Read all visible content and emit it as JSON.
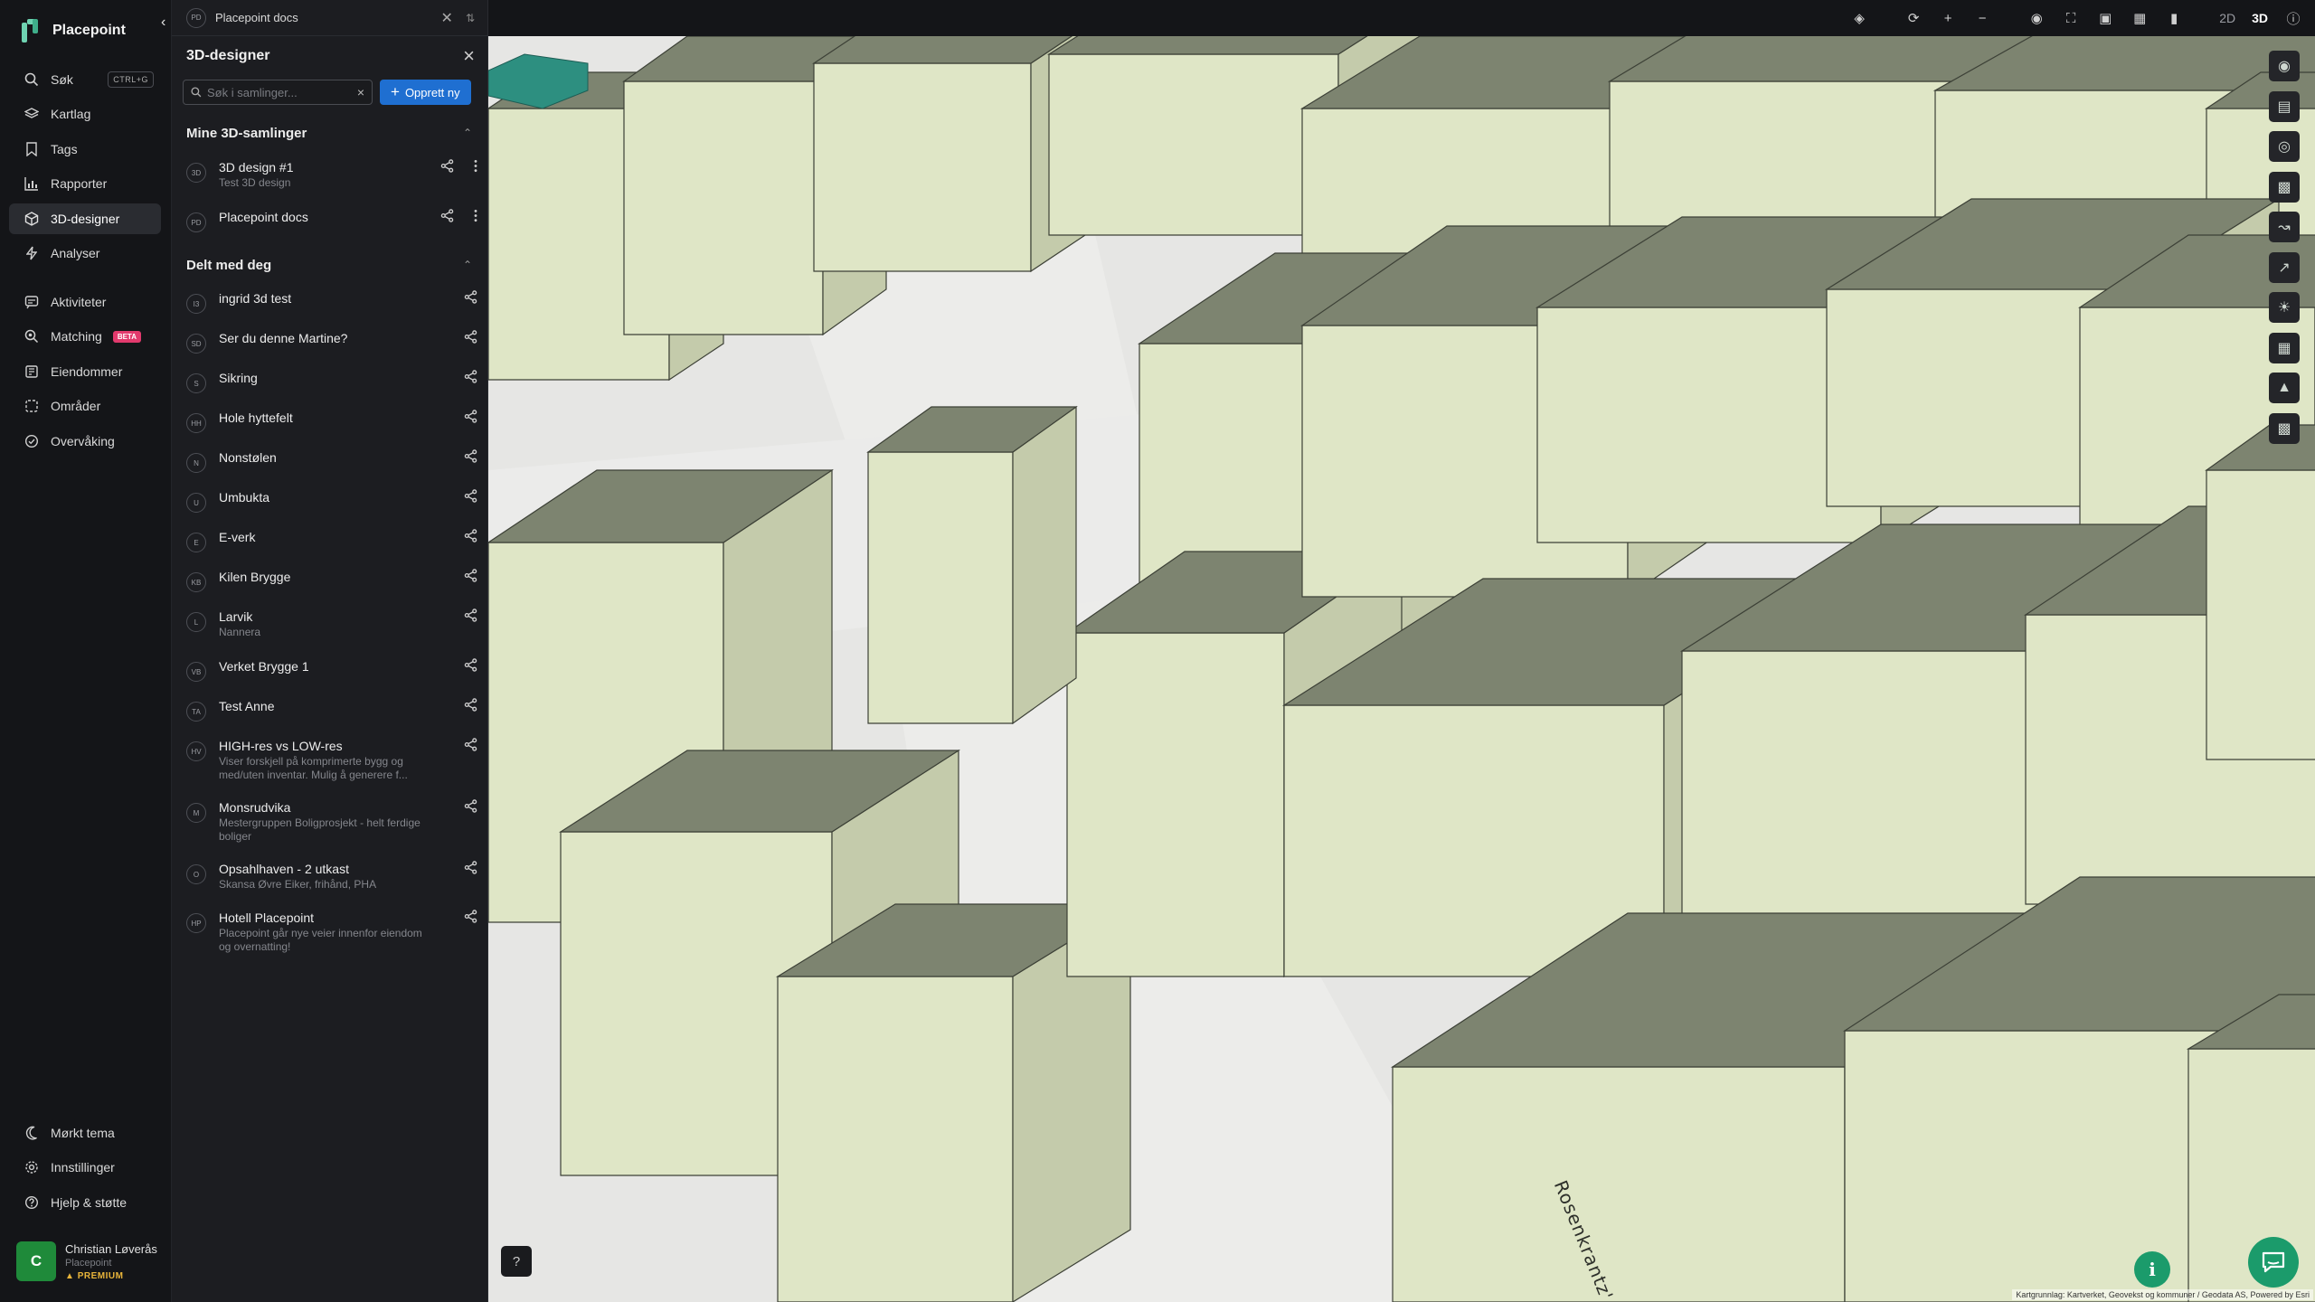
{
  "app": {
    "brand": "Placepoint"
  },
  "nav": {
    "search": {
      "label": "Søk",
      "shortcut": "CTRL+G"
    },
    "items": [
      {
        "label": "Kartlag",
        "icon": "layers-icon"
      },
      {
        "label": "Tags",
        "icon": "bookmark-icon"
      },
      {
        "label": "Rapporter",
        "icon": "bar-chart-icon"
      },
      {
        "label": "3D-designer",
        "icon": "cube-icon",
        "active": true
      },
      {
        "label": "Analyser",
        "icon": "bolt-icon"
      },
      {
        "label": "Aktiviteter",
        "icon": "activity-icon"
      },
      {
        "label": "Matching",
        "icon": "match-icon",
        "badge": "BETA"
      },
      {
        "label": "Eiendommer",
        "icon": "property-icon"
      },
      {
        "label": "Områder",
        "icon": "area-icon"
      },
      {
        "label": "Overvåking",
        "icon": "monitor-icon"
      }
    ],
    "bottom": [
      {
        "label": "Mørkt tema",
        "icon": "moon-icon"
      },
      {
        "label": "Innstillinger",
        "icon": "gear-icon"
      },
      {
        "label": "Hjelp & støtte",
        "icon": "help-icon"
      }
    ],
    "user": {
      "initial": "C",
      "name": "Christian Løverås",
      "org": "Placepoint",
      "plan": "PREMIUM"
    }
  },
  "panel": {
    "context": {
      "initials": "PD",
      "title": "Placepoint docs"
    },
    "title": "3D-designer",
    "search_placeholder": "Søk i samlinger...",
    "new_button": "Opprett ny",
    "my_section": "Mine 3D-samlinger",
    "my_items": [
      {
        "initials": "3D",
        "name": "3D design #1",
        "sub": "Test 3D design"
      },
      {
        "initials": "PD",
        "name": "Placepoint docs",
        "sub": ""
      }
    ],
    "shared_section": "Delt med deg",
    "shared_items": [
      {
        "initials": "I3",
        "name": "ingrid 3d test",
        "sub": ""
      },
      {
        "initials": "SD",
        "name": "Ser du denne Martine?",
        "sub": ""
      },
      {
        "initials": "S",
        "name": "Sikring",
        "sub": ""
      },
      {
        "initials": "HH",
        "name": "Hole hyttefelt",
        "sub": ""
      },
      {
        "initials": "N",
        "name": "Nonstølen",
        "sub": ""
      },
      {
        "initials": "U",
        "name": "Umbukta",
        "sub": ""
      },
      {
        "initials": "E",
        "name": "E-verk",
        "sub": ""
      },
      {
        "initials": "KB",
        "name": "Kilen Brygge",
        "sub": ""
      },
      {
        "initials": "L",
        "name": "Larvik",
        "sub": "Nannera"
      },
      {
        "initials": "VB",
        "name": "Verket Brygge 1",
        "sub": ""
      },
      {
        "initials": "TA",
        "name": "Test Anne",
        "sub": ""
      },
      {
        "initials": "HV",
        "name": "HIGH-res vs LOW-res",
        "sub": "Viser forskjell på komprimerte bygg og med/uten inventar. Mulig å generere f..."
      },
      {
        "initials": "M",
        "name": "Monsrudvika",
        "sub": "Mestergruppen Boligprosjekt - helt ferdige boliger"
      },
      {
        "initials": "O",
        "name": "Opsahlhaven - 2 utkast",
        "sub": "Skansa Øvre Eiker, frihånd, PHA"
      },
      {
        "initials": "HP",
        "name": "Hotell Placepoint",
        "sub": "Placepoint går nye veier innenfor eiendom og overnatting!"
      }
    ]
  },
  "map": {
    "view_modes": {
      "two_d": "2D",
      "three_d": "3D",
      "active": "3D"
    },
    "street_label": "Rosenkrantz' gate",
    "attribution": "Kartgrunnlag: Kartverket, Geovekst og kommuner / Geodata AS, Powered by Esri",
    "building_colors": {
      "light": "#dfe6c6",
      "mid": "#c4cbab",
      "dark": "#7d8470",
      "road": "#e8e8e6"
    }
  }
}
